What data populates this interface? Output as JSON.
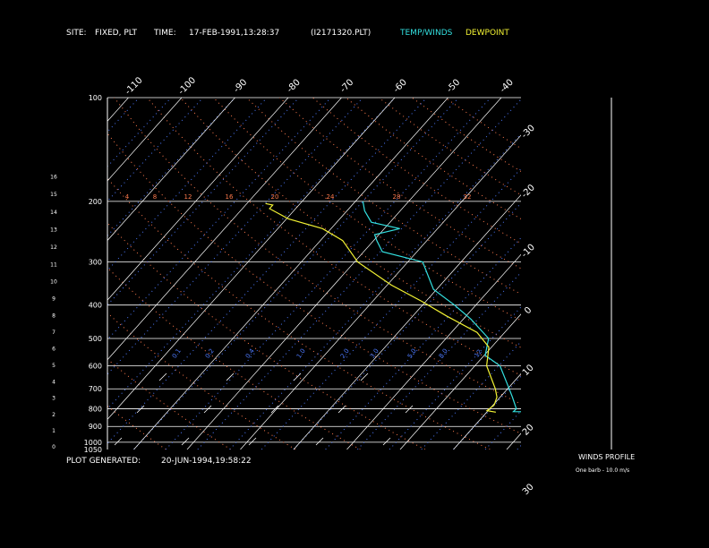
{
  "header": {
    "site_label": "SITE:",
    "site_value": "FIXED, PLT",
    "time_label": "TIME:",
    "time_value": "17-FEB-1991,13:28:37",
    "file_name": "(I2171320.PLT)",
    "temp_winds_label": "TEMP/WINDS",
    "dewpoint_label": "DEWPOINT"
  },
  "footer": {
    "generated_label": "PLOT GENERATED:",
    "generated_value": "20-JUN-1994,19:58:22"
  },
  "winds_panel": {
    "title": "WINDS PROFILE",
    "barb_note": "One barb - 10.0 m/s"
  },
  "colors": {
    "background": "#000000",
    "grid": "#ffffff",
    "temperature": "#33e0e0",
    "dewpoint": "#f2f233",
    "dry_adiabat": "#ff7a4d",
    "mixing_ratio": "#4d7aff",
    "tick_text": "#ffffff"
  },
  "chart_data": {
    "type": "line",
    "title": "",
    "xlabel": "",
    "ylabel": "",
    "y_scale": "log-pressure",
    "ylim": [
      1050,
      100
    ],
    "xlim": [
      -40,
      40
    ],
    "pressure_ticks": [
      100,
      200,
      300,
      400,
      500,
      600,
      700,
      800,
      900,
      1000,
      1050
    ],
    "height_km_ticks": [
      0,
      1,
      2,
      3,
      4,
      5,
      6,
      7,
      8,
      9,
      10,
      11,
      12,
      13,
      14,
      15,
      16
    ],
    "isotherm_labels_top": [
      "-110",
      "-100",
      "-90",
      "-80",
      "-70",
      "-60",
      "-50",
      "-40"
    ],
    "isotherm_labels_right": [
      "-30",
      "-20",
      "-10",
      "0",
      "10",
      "20",
      "30"
    ],
    "isotherm_values_top": [
      -110,
      -100,
      -90,
      -80,
      -70,
      -60,
      -50,
      -40
    ],
    "isotherm_values_right": [
      -30,
      -20,
      -10,
      0,
      10,
      20,
      30
    ],
    "dry_adiabat_labels": [
      "4",
      "8",
      "12",
      "16",
      "20",
      "24",
      "28",
      "32"
    ],
    "mixing_ratio_labels": [
      "0.1",
      "0.2",
      "0.4",
      "1.0",
      "2.0",
      "3.0",
      "5.0",
      "8.0",
      "12"
    ],
    "grid": true,
    "series": [
      {
        "name": "TEMP/WINDS",
        "points": [
          [
            818,
            22.7
          ],
          [
            815,
            14.9
          ],
          [
            800,
            15.0
          ],
          [
            740,
            12.3
          ],
          [
            700,
            10.3
          ],
          [
            600,
            4.7
          ],
          [
            560,
            0.2
          ],
          [
            500,
            -2.0
          ],
          [
            440,
            -8.5
          ],
          [
            400,
            -14.0
          ],
          [
            360,
            -20.6
          ],
          [
            300,
            -27.2
          ],
          [
            280,
            -36.5
          ],
          [
            260,
            -39.4
          ],
          [
            250,
            -40.8
          ],
          [
            240,
            -37.1
          ],
          [
            230,
            -43.5
          ],
          [
            213,
            -46.7
          ],
          [
            200,
            -48.6
          ]
        ]
      },
      {
        "name": "DEWPOINT",
        "points": [
          [
            818,
            11.7
          ],
          [
            810,
            9.8
          ],
          [
            780,
            10.2
          ],
          [
            740,
            9.4
          ],
          [
            700,
            7.7
          ],
          [
            600,
            2.2
          ],
          [
            530,
            -0.5
          ],
          [
            480,
            -5.2
          ],
          [
            430,
            -13.7
          ],
          [
            390,
            -20.8
          ],
          [
            350,
            -29.2
          ],
          [
            300,
            -39.4
          ],
          [
            260,
            -45.8
          ],
          [
            240,
            -51.6
          ],
          [
            225,
            -59.6
          ],
          [
            210,
            -64.9
          ],
          [
            205,
            -64.9
          ],
          [
            203,
            -66.5
          ]
        ]
      }
    ]
  }
}
